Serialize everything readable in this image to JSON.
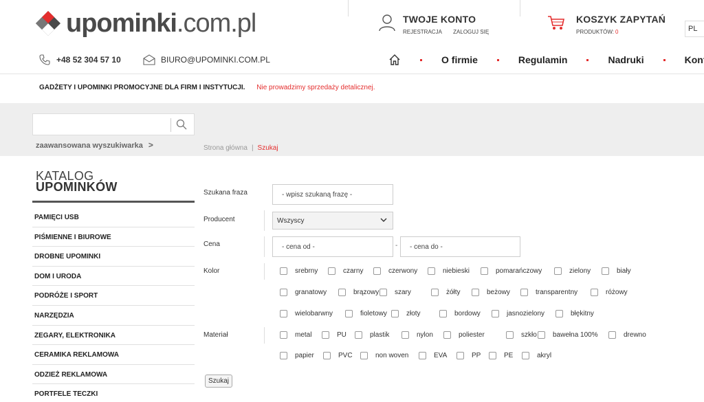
{
  "header": {
    "logo_brand": "upominki",
    "logo_domain": ".com.pl",
    "account_title": "TWOJE KONTO",
    "account_register": "REJESTRACJA",
    "account_login": "ZALOGUJ SIĘ",
    "cart_title": "KOSZYK ZAPYTAŃ",
    "cart_label": "PRODUKTÓW:",
    "cart_count": "0",
    "lang": "PL",
    "phone": "+48 52 304 57 10",
    "email": "BIURO@UPOMINKI.COM.PL",
    "nav": [
      "O firmie",
      "Regulamin",
      "Nadruki",
      "Kont"
    ],
    "tagline_main": "GADŻETY I UPOMINKI PROMOCYJNE DLA FIRM I INSTYTUCJI.",
    "tagline_note": "Nie prowadzimy sprzedaży detalicznej."
  },
  "search": {
    "placeholder": "",
    "advanced": "zaawansowana wyszukiwarka",
    "advanced_chevron": ">"
  },
  "breadcrumb": {
    "home": "Strona główna",
    "sep": "|",
    "current": "Szukaj"
  },
  "catalog": {
    "title1": "KATALOG",
    "title2": "UPOMINKÓW",
    "items": [
      "PAMIĘCI USB",
      "PIŚMIENNE I BIUROWE",
      "DROBNE UPOMINKI",
      "DOM I URODA",
      "PODRÓŻE I SPORT",
      "NARZĘDZIA",
      "ZEGARY, ELEKTRONIKA",
      "CERAMIKA REKLAMOWA",
      "ODZIEŻ REKLAMOWA",
      "PORTFELE TECZKI"
    ]
  },
  "form": {
    "phrase_label": "Szukana fraza",
    "phrase_value": "- wpisz szukaną frazę -",
    "producer_label": "Producent",
    "producer_value": "Wszyscy",
    "price_label": "Cena",
    "price_from": "- cena od -",
    "price_dash": "-",
    "price_to": "- cena do -",
    "color_label": "Kolor",
    "colors": [
      "srebrny",
      "czarny",
      "czerwony",
      "niebieski",
      "pomarańczowy",
      "zielony",
      "biały",
      "granatowy",
      "brązowy",
      "szary",
      "żółty",
      "beżowy",
      "transparentny",
      "różowy",
      "wielobarwny",
      "fioletowy",
      "złoty",
      "bordowy",
      "jasnozielony",
      "błękitny"
    ],
    "material_label": "Materiał",
    "materials": [
      "metal",
      "PU",
      "plastik",
      "nylon",
      "poliester",
      "szkło",
      "bawełna 100%",
      "drewno",
      "papier",
      "PVC",
      "non woven",
      "EVA",
      "PP",
      "PE",
      "akryl"
    ],
    "submit": "Szukaj"
  },
  "colors": {
    "accent": "#e42d2d",
    "band": "#eeeeee"
  }
}
